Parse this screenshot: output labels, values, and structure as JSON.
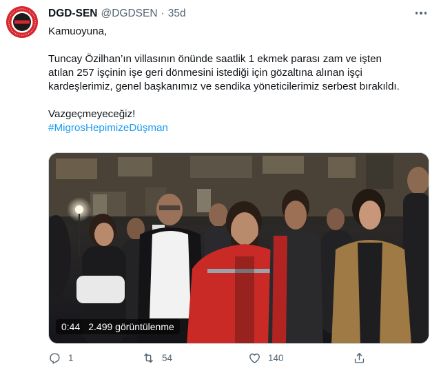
{
  "account": {
    "display_name": "DGD-SEN",
    "handle": "@DGDSEN",
    "separator": "·",
    "time": "35d"
  },
  "tweet": {
    "lines": [
      "Kamuoyuna,",
      "",
      "Tuncay Özilhan’ın villasının önünde saatlik 1 ekmek parası zam ve işten",
      "atılan 257 işçinin işe geri dönmesini istediği için gözaltına alınan işçi",
      "kardeşlerimiz, genel başkanımız ve sendika yöneticilerimiz serbest bırakıldı.",
      "",
      "Vazgeçmeyeceğiz!"
    ],
    "hashtag": "#MigrosHepimizeDüşman"
  },
  "video": {
    "duration": "0:44",
    "views": "2.499 görüntülenme"
  },
  "actions": {
    "reply_count": "1",
    "retweet_count": "54",
    "like_count": "140"
  },
  "colors": {
    "link": "#1d9bf0",
    "secondary_text": "#536471",
    "logo_red": "#d7262d"
  },
  "icons": {
    "more": "more-icon",
    "reply": "reply-icon",
    "retweet": "retweet-icon",
    "like": "heart-icon",
    "share": "share-icon"
  }
}
